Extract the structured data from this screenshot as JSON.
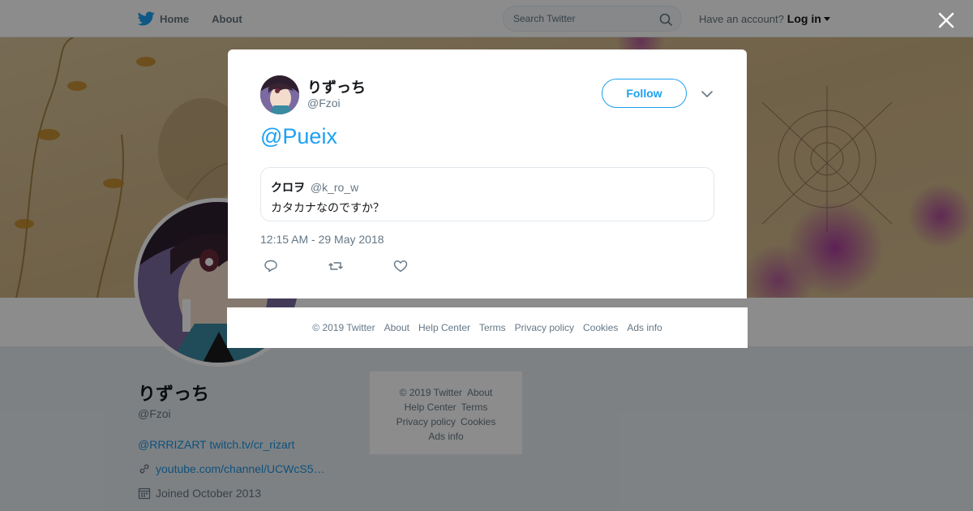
{
  "topbar": {
    "home_label": "Home",
    "about_label": "About",
    "search_placeholder": "Search Twitter",
    "have_account": "Have an account?",
    "login_label": "Log in"
  },
  "profile": {
    "name": "りずっち",
    "handle": "@Fzoi",
    "bio": "@RRRIZART twitch.tv/cr_rizart",
    "link": "youtube.com/channel/UCWcS5…",
    "joined": "Joined October 2013"
  },
  "side_footer": {
    "copyright": "© 2019 Twitter",
    "about": "About",
    "help": "Help Center",
    "terms": "Terms",
    "privacy": "Privacy policy",
    "cookies": "Cookies",
    "ads": "Ads info"
  },
  "modal": {
    "name": "りずっち",
    "handle": "@Fzoi",
    "follow_label": "Follow",
    "tweet_text": "@Pueix",
    "quote": {
      "name": "クロヲ",
      "handle": "@k_ro_w",
      "text": "カタカナなのですか？"
    },
    "timestamp": "12:15 AM - 29 May 2018"
  },
  "modal_footer": {
    "copyright": "© 2019 Twitter",
    "about": "About",
    "help": "Help Center",
    "terms": "Terms",
    "privacy": "Privacy policy",
    "cookies": "Cookies",
    "ads": "Ads info"
  },
  "colors": {
    "accent": "#1da1f2",
    "link": "#1b95e0",
    "overlay": "rgba(0,0,0,0.45)"
  }
}
